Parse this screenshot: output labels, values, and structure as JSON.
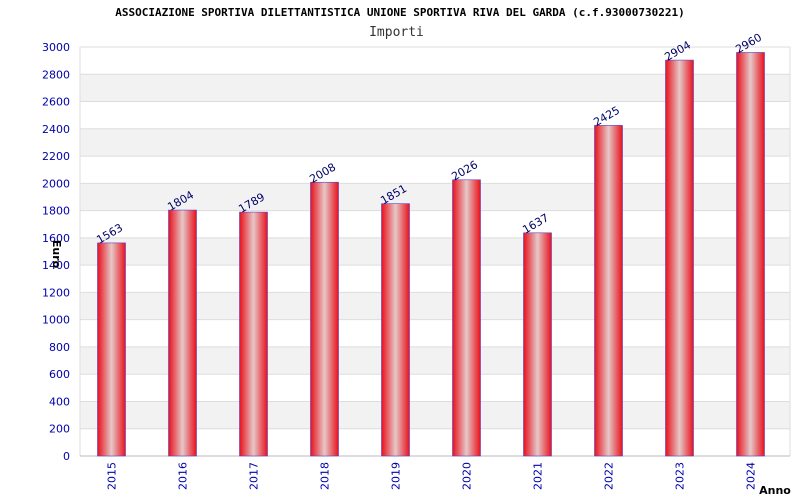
{
  "chart_data": {
    "type": "bar",
    "title": "ASSOCIAZIONE SPORTIVA DILETTANTISTICA UNIONE SPORTIVA RIVA DEL GARDA (c.f.93000730221)",
    "subtitle": "Importi",
    "xlabel": "Anno",
    "ylabel": "Euro",
    "categories": [
      "2015",
      "2016",
      "2017",
      "2018",
      "2019",
      "2020",
      "2021",
      "2022",
      "2023",
      "2024"
    ],
    "values": [
      1563,
      1804,
      1789,
      2008,
      1851,
      2026,
      1637,
      2425,
      2904,
      2960
    ],
    "data_labels": [
      "1563",
      "1804",
      "1789",
      "2008",
      "1851",
      "2026",
      "1637",
      "2425",
      "2904",
      "2960"
    ],
    "yticks": [
      0,
      200,
      400,
      600,
      800,
      1000,
      1200,
      1400,
      1600,
      1800,
      2000,
      2200,
      2400,
      2600,
      2800,
      3000
    ],
    "ylim": [
      0,
      3000
    ],
    "grid": true,
    "colors": {
      "bar_edge": "#e8101a",
      "bar_center": "#e6c8c8",
      "bar_outline": "#5a3fd0",
      "tick_text": "#0000aa",
      "grid_band": "#f2f2f2",
      "grid_line": "#dddddd"
    }
  }
}
